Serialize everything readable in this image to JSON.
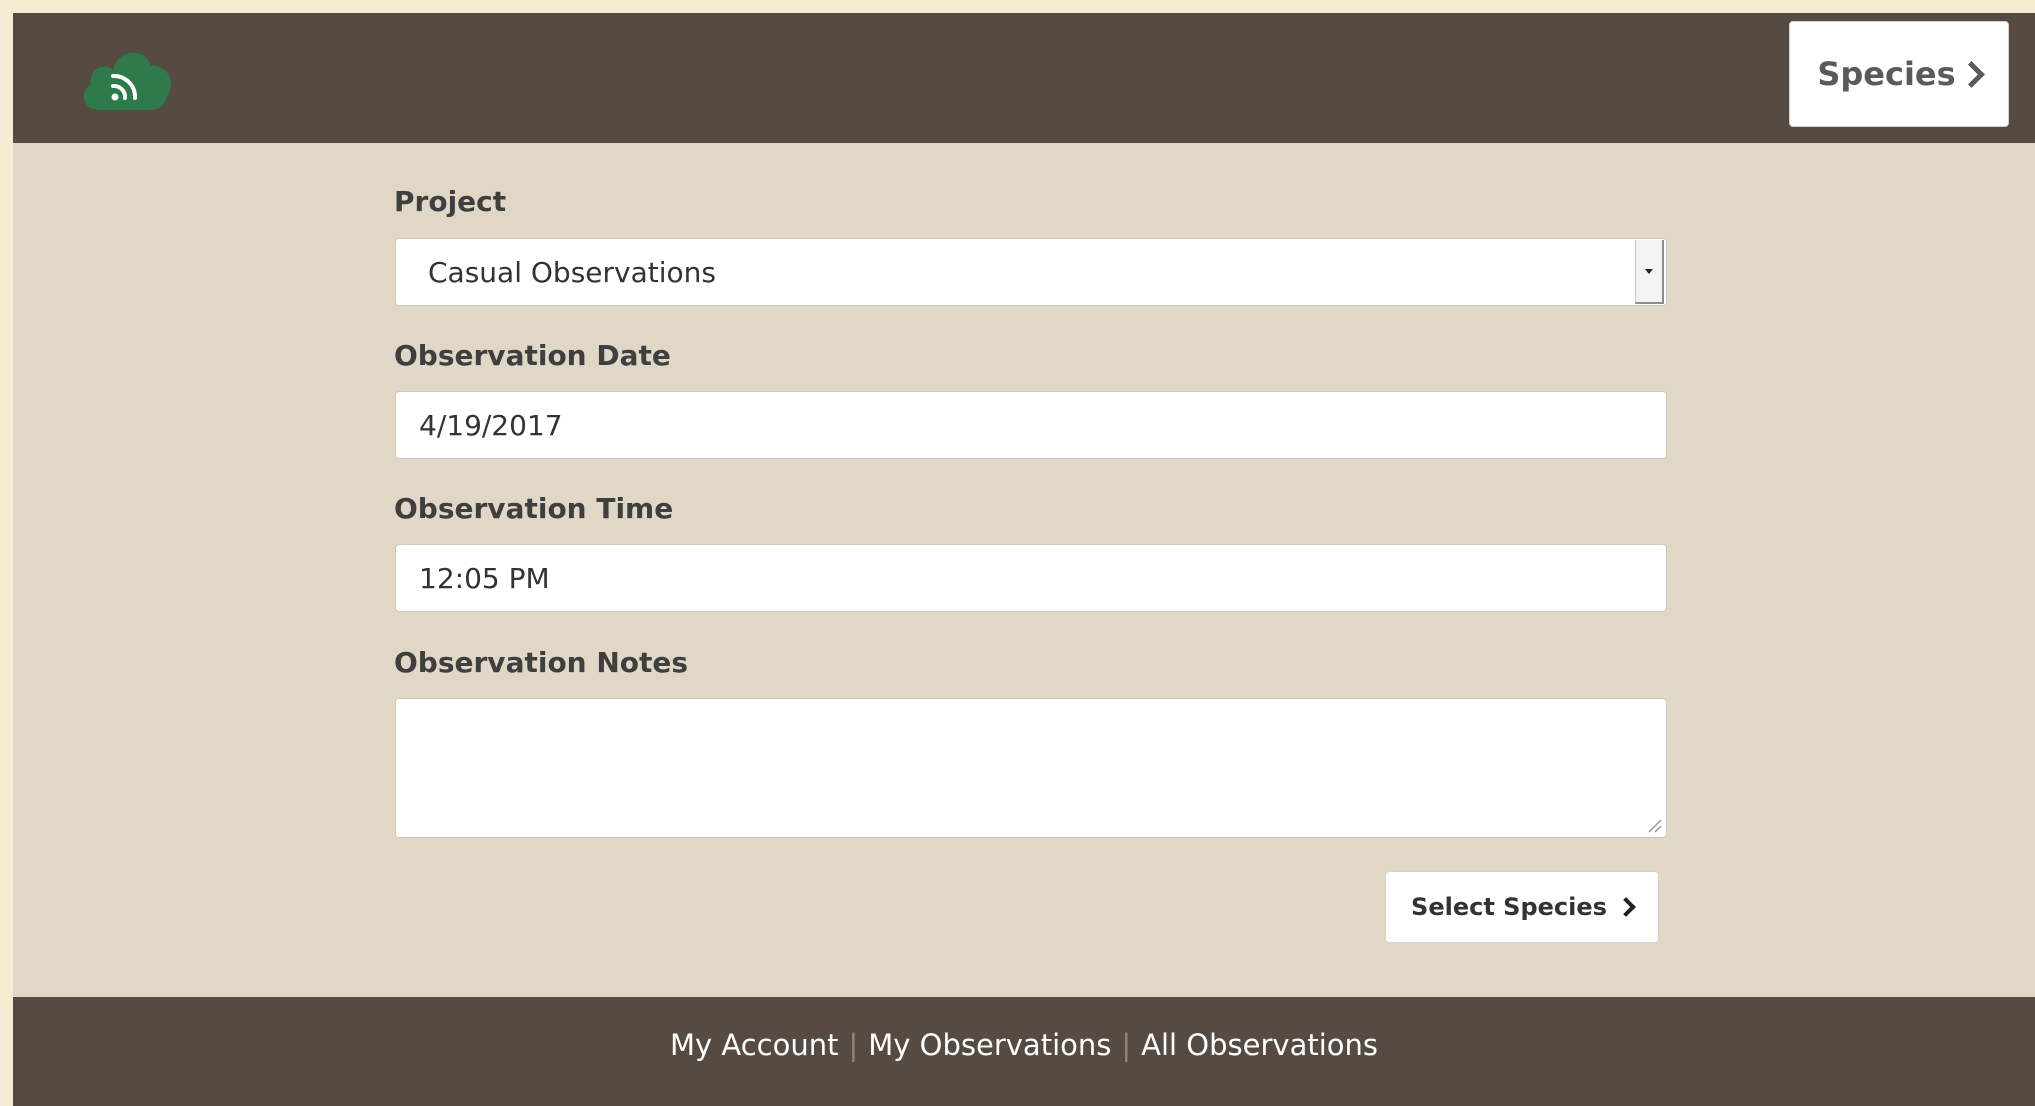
{
  "header": {
    "logo_icon": "cloud-rss-icon",
    "species_button": {
      "label": "Species",
      "icon": "chevron-right-icon"
    }
  },
  "form": {
    "project": {
      "label": "Project",
      "value": "Casual Observations"
    },
    "date": {
      "label": "Observation Date",
      "value": "4/19/2017"
    },
    "time": {
      "label": "Observation Time",
      "value": "12:05 PM"
    },
    "notes": {
      "label": "Observation Notes",
      "value": ""
    },
    "submit": {
      "label": "Select Species",
      "icon": "chevron-right-icon"
    }
  },
  "footer": {
    "links": [
      "My Account",
      "My Observations",
      "All Observations"
    ],
    "separator": "|"
  },
  "colors": {
    "bar": "#554b42",
    "body": "#e1d7c6",
    "logo": "#2f7a4a"
  }
}
